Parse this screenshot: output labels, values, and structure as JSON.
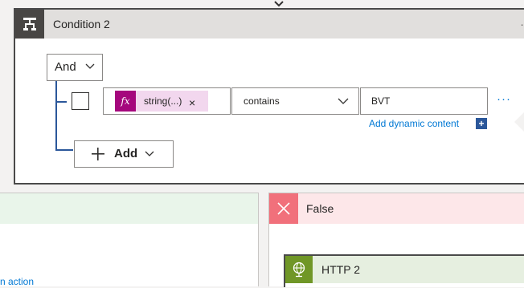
{
  "condition": {
    "title": "Condition 2",
    "group_operator": "And",
    "row": {
      "left_token": {
        "icon": "fx-icon",
        "label": "string(...)",
        "remove": "×"
      },
      "operator": "contains",
      "value": "BVT",
      "more": "···"
    },
    "add_dynamic_content": "Add dynamic content",
    "add_button_label": "Add",
    "header_menu": "…"
  },
  "branches": {
    "true": {
      "add_action_text": "n action"
    },
    "false": {
      "label": "False"
    }
  },
  "http2": {
    "title": "HTTP 2",
    "icon": "globe-icon"
  },
  "colors": {
    "accent": "#0078d4",
    "condition_icon_bg": "#484644",
    "token_bg": "#f2d7ee",
    "token_icon_bg": "#a5077d",
    "false_bg": "#fde7e9",
    "false_icon_bg": "#f1707b",
    "true_header_bg": "#e9f5ea",
    "http_icon_bg": "#709727"
  }
}
